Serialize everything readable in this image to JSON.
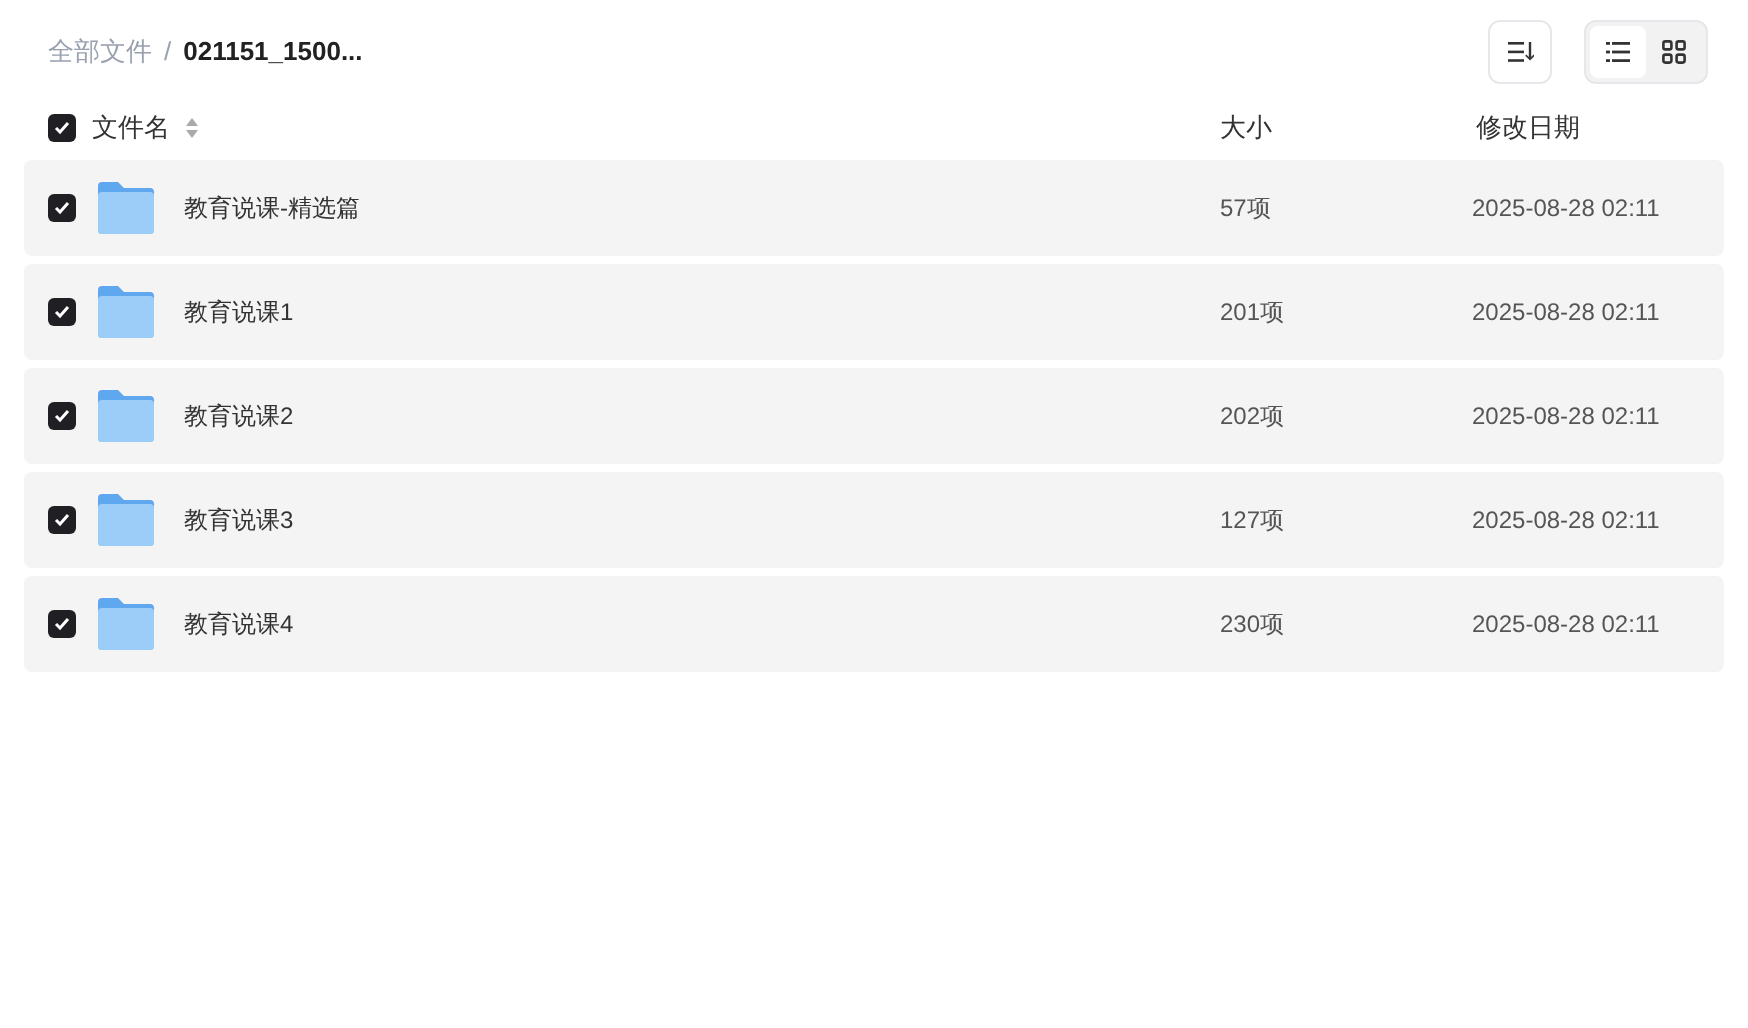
{
  "breadcrumb_separator": "/",
  "breadcrumb": [
    {
      "label": "全部文件",
      "current": false
    },
    {
      "label": "021151_1500...",
      "current": true
    }
  ],
  "view_toggle": [
    {
      "kind": "list",
      "selected": true
    },
    {
      "kind": "grid",
      "selected": false
    }
  ],
  "header": {
    "checked": true,
    "columns": [
      "文件名",
      "大小",
      "修改日期"
    ]
  },
  "rows": [
    {
      "name": "教育说课-精选篇",
      "size": "57项",
      "date": "2025-08-28 02:11",
      "checked": true
    },
    {
      "name": "教育说课1",
      "size": "201项",
      "date": "2025-08-28 02:11",
      "checked": true
    },
    {
      "name": "教育说课2",
      "size": "202项",
      "date": "2025-08-28 02:11",
      "checked": true
    },
    {
      "name": "教育说课3",
      "size": "127项",
      "date": "2025-08-28 02:11",
      "checked": true
    },
    {
      "name": "教育说课4",
      "size": "230项",
      "date": "2025-08-28 02:11",
      "checked": true
    }
  ]
}
